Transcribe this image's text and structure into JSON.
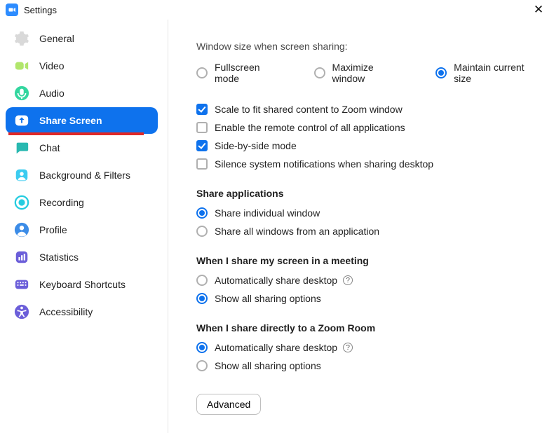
{
  "window": {
    "title": "Settings"
  },
  "sidebar": {
    "items": [
      {
        "label": "General",
        "icon": "gear"
      },
      {
        "label": "Video",
        "icon": "video"
      },
      {
        "label": "Audio",
        "icon": "audio"
      },
      {
        "label": "Share Screen",
        "icon": "share",
        "active": true
      },
      {
        "label": "Chat",
        "icon": "chat"
      },
      {
        "label": "Background & Filters",
        "icon": "bgfilters"
      },
      {
        "label": "Recording",
        "icon": "recording"
      },
      {
        "label": "Profile",
        "icon": "profile"
      },
      {
        "label": "Statistics",
        "icon": "stats"
      },
      {
        "label": "Keyboard Shortcuts",
        "icon": "keyboard"
      },
      {
        "label": "Accessibility",
        "icon": "accessibility"
      }
    ]
  },
  "pane": {
    "windowSizeLabel": "Window size when screen sharing:",
    "windowSizeOptions": {
      "fullscreen": "Fullscreen mode",
      "maximize": "Maximize window",
      "maintain": "Maintain current size"
    },
    "checks": {
      "scale": "Scale to fit shared content to Zoom window",
      "remote": "Enable the remote control of all applications",
      "sidebyside": "Side-by-side mode",
      "silence": "Silence system notifications when sharing desktop"
    },
    "shareAppsHeading": "Share applications",
    "shareAppsOptions": {
      "individual": "Share individual window",
      "all": "Share all windows from an application"
    },
    "meetingHeading": "When I share my screen in a meeting",
    "meetingOptions": {
      "auto": "Automatically share desktop",
      "show": "Show all sharing options"
    },
    "zoomRoomHeading": "When I share directly to a Zoom Room",
    "zoomRoomOptions": {
      "auto": "Automatically share desktop",
      "show": "Show all sharing options"
    },
    "advancedBtn": "Advanced"
  },
  "icons": {
    "gear_color": "#D9D9D9",
    "video_color": "#B1E66C",
    "audio_color": "#33D69F",
    "share_color_active": "#FFFFFF",
    "chat_color": "#28B8B0",
    "bg_color": "#3CCCF0",
    "rec_color": "#25CCE0",
    "profile_color": "#3C8CE7",
    "stats_color": "#6B5ED9",
    "keyboard_color": "#6B5ED9",
    "access_color": "#6B5ED9",
    "active_bg": "#0E72ED"
  }
}
